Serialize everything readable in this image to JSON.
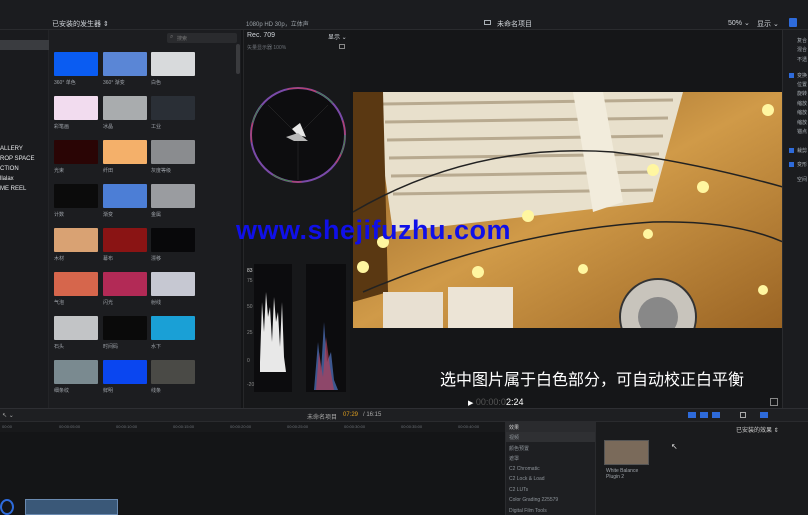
{
  "topbar": {
    "generators_title": "已安装的发生器 ⇕",
    "format": "1080p HD 30p，立体声",
    "project_name": "未命名项目",
    "zoom": "50% ⌄",
    "display_menu": "显示 ⌄"
  },
  "sidebar": {
    "items": [
      "ALLERY",
      "ROP SPACE",
      "CTION",
      "llalax",
      "ME REEL"
    ]
  },
  "generators": {
    "search_placeholder": "搜索",
    "items": [
      {
        "label": "360° 单色",
        "color": "#0a5cf2"
      },
      {
        "label": "360° 渐变",
        "color": "#5a86d6"
      },
      {
        "label": "白色",
        "color": "#d8dadc"
      },
      {
        "label": "彩笔画",
        "color": "#f2dcef"
      },
      {
        "label": "冰晶",
        "color": "#a9acae"
      },
      {
        "label": "工业",
        "color": "#2a2f36"
      },
      {
        "label": "光束",
        "color": "#2a0505"
      },
      {
        "label": "纤田",
        "color": "#f4b06a"
      },
      {
        "label": "灰度等级",
        "color": "#8a8c8f"
      },
      {
        "label": "计数",
        "color": "#0b0b0b"
      },
      {
        "label": "渐变",
        "color": "#4c7ed6"
      },
      {
        "label": "金属",
        "color": "#9a9ca0"
      },
      {
        "label": "木材",
        "color": "#d9a273"
      },
      {
        "label": "幕布",
        "color": "#8a1414"
      },
      {
        "label": "漂移",
        "color": "#08080a"
      },
      {
        "label": "气泡",
        "color": "#d6664c"
      },
      {
        "label": "闪光",
        "color": "#b22a56"
      },
      {
        "label": "射线",
        "color": "#c6c8d2"
      },
      {
        "label": "石头",
        "color": "#c2c4c6"
      },
      {
        "label": "时间码",
        "color": "#0a0a0a"
      },
      {
        "label": "水下",
        "color": "#1aa0d6"
      },
      {
        "label": "细条纹",
        "color": "#7a8a90"
      },
      {
        "label": "鲜明",
        "color": "#0a46f0"
      },
      {
        "label": "线条",
        "color": "#4a4a46"
      }
    ]
  },
  "scopes": {
    "title": "Rec. 709",
    "settings": "显示 ⌄",
    "vectorscope_label": "矢量显示器 100%",
    "scale": [
      "83",
      "75",
      "50",
      "25",
      "0",
      "-20"
    ]
  },
  "viewer": {
    "timecode": "00:00:02:24",
    "timecode_dim": "00:00:0",
    "timecode_bright": "2:24",
    "watermark": "www.shejifuzhu.com",
    "subtitle": "选中图片属于白色部分，可自动校正白平衡"
  },
  "inspector": {
    "items": [
      "复合",
      "混合",
      "不透",
      "变换",
      "位置",
      "旋转",
      "缩放",
      "缩放",
      "缩放",
      "锚点",
      "裁剪",
      "变形",
      "空间"
    ]
  },
  "timeline": {
    "project": "未命名项目",
    "time_current": "07:29",
    "time_total": "/ 16:15",
    "ruler": [
      "00:00",
      "00:00:05:00",
      "00:00:10:00",
      "00:00:15:00",
      "00:00:20:00",
      "00:00:25:00",
      "00:00:30:00",
      "00:00:35:00",
      "00:00:40:00"
    ]
  },
  "effects": {
    "header": "效果",
    "categories": [
      "视频",
      "颜色预置",
      "遮罩",
      "C2 Chromatic",
      "C2 Lock & Load",
      "C2 LUTs",
      "Color Grading 225579",
      "Digital Film Tools"
    ],
    "installed_label": "已安装的效果 ⇕",
    "effect_name_1": "White Balance",
    "effect_name_2": "Plugin 2"
  },
  "colors": {
    "accent": "#2e6bdb",
    "video_warm": "#c8862c",
    "timecode_current": "#e0a020"
  }
}
